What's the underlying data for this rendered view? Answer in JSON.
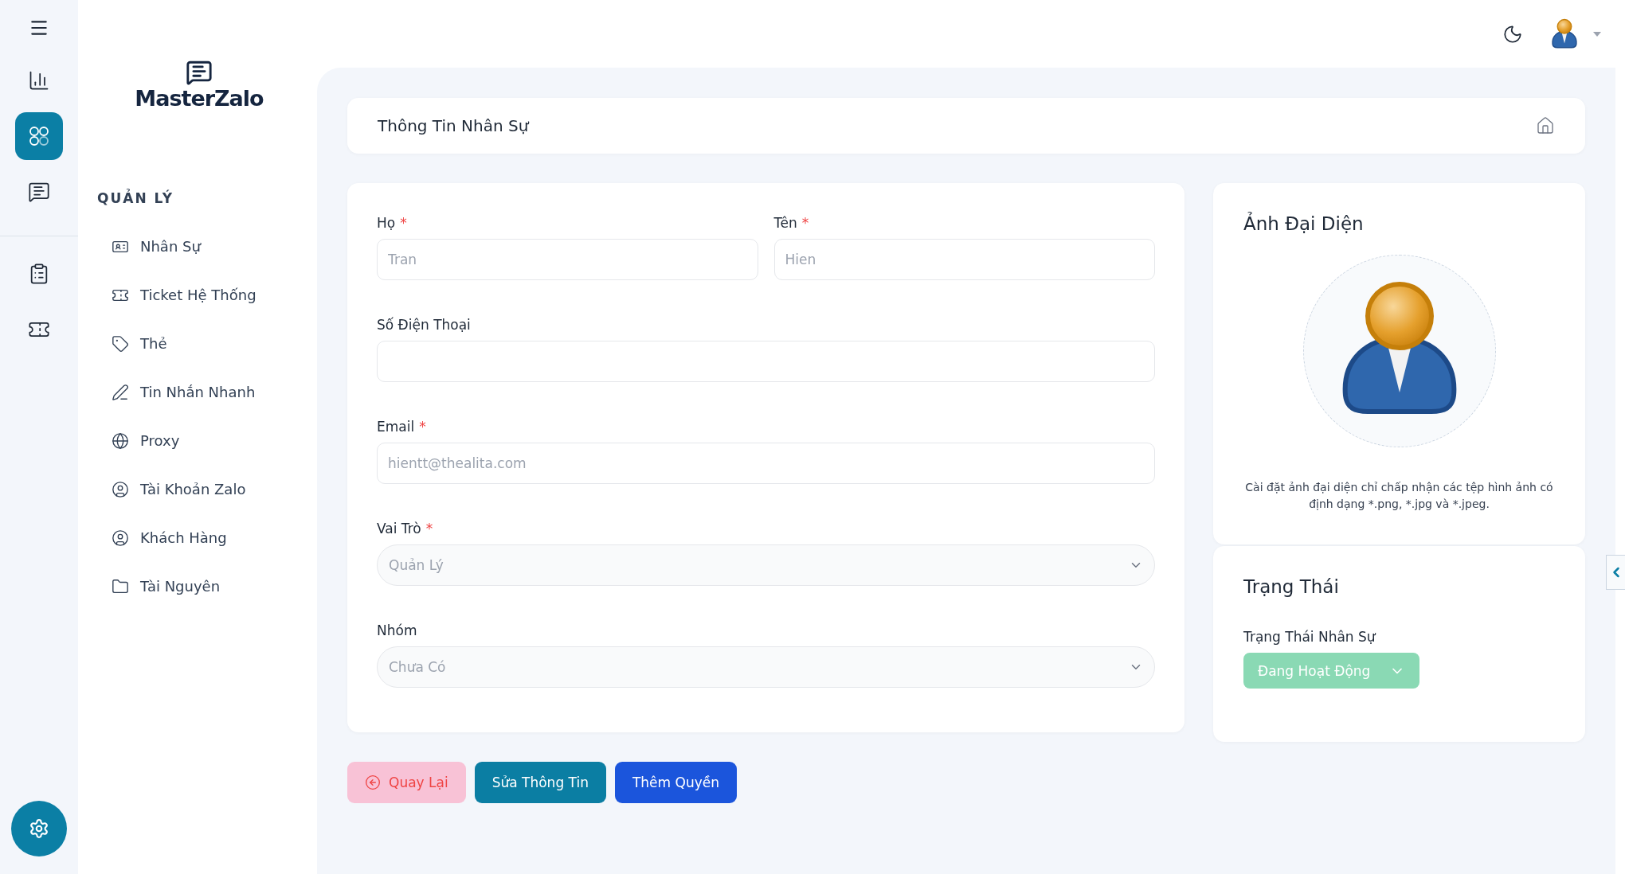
{
  "rail": {
    "items": [
      {
        "selected": false
      },
      {
        "selected": true
      },
      {
        "selected": false
      },
      {
        "selected": false
      },
      {
        "selected": false
      }
    ]
  },
  "logo": {
    "text": "MasterZalo"
  },
  "sidebar": {
    "section_title": "QUẢN LÝ",
    "items": [
      {
        "label": "Nhân Sự"
      },
      {
        "label": "Ticket Hệ Thống"
      },
      {
        "label": "Thẻ"
      },
      {
        "label": "Tin Nhắn Nhanh"
      },
      {
        "label": "Proxy"
      },
      {
        "label": "Tài Khoản Zalo"
      },
      {
        "label": "Khách Hàng"
      },
      {
        "label": "Tài Nguyên"
      }
    ]
  },
  "page_header": {
    "title": "Thông Tin Nhân Sự"
  },
  "form": {
    "rows": [
      [
        {
          "kind": "text",
          "label": "Họ",
          "required_mark": "*",
          "value": "Tran",
          "disabled": true
        },
        {
          "kind": "text",
          "label": "Tên",
          "required_mark": "*",
          "value": "Hien",
          "disabled": true
        }
      ],
      [
        {
          "kind": "text",
          "label": "Số Điện Thoại"
        }
      ],
      [
        {
          "kind": "text",
          "label": "Email",
          "required_mark": "*",
          "value": "hientt@thealita.com",
          "disabled": true
        }
      ],
      [
        {
          "kind": "select",
          "label": "Vai Trò",
          "required_mark": "*",
          "value": "Quản Lý",
          "disabled": true
        }
      ],
      [
        {
          "kind": "select",
          "label": "Nhóm",
          "value": "Chưa Có",
          "disabled": true
        }
      ]
    ]
  },
  "actions": [
    {
      "kind": "back",
      "label": "Quay Lại"
    },
    {
      "kind": "edit",
      "label": "Sửa Thông Tin"
    },
    {
      "kind": "add",
      "label": "Thêm Quyền"
    }
  ],
  "avatar_card": {
    "title": "Ảnh Đại Diện",
    "note": "Cài đặt ảnh đại diện chỉ chấp nhận các tệp hình ảnh có định dạng *.png, *.jpg và *.jpeg."
  },
  "status_card": {
    "title": "Trạng Thái",
    "label": "Trạng Thái Nhân Sự",
    "value": "Đang Hoạt Động"
  }
}
